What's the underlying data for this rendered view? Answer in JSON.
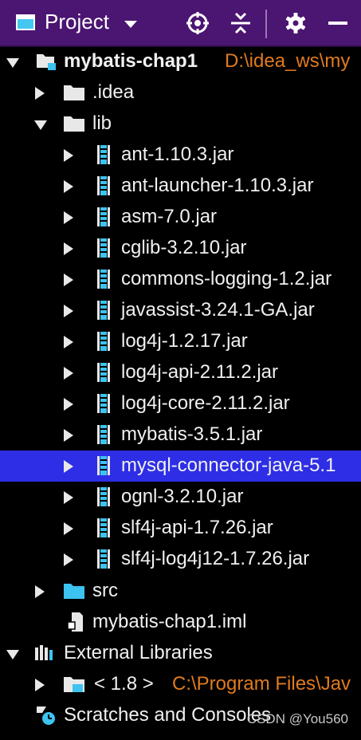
{
  "header": {
    "title": "Project"
  },
  "tree": {
    "root": {
      "label": "mybatis-chap1",
      "path": "D:\\idea_ws\\my"
    },
    "idea": {
      "label": ".idea"
    },
    "lib": {
      "label": "lib",
      "jars": [
        "ant-1.10.3.jar",
        "ant-launcher-1.10.3.jar",
        "asm-7.0.jar",
        "cglib-3.2.10.jar",
        "commons-logging-1.2.jar",
        "javassist-3.24.1-GA.jar",
        "log4j-1.2.17.jar",
        "log4j-api-2.11.2.jar",
        "log4j-core-2.11.2.jar",
        "mybatis-3.5.1.jar",
        "mysql-connector-java-5.1",
        "ognl-3.2.10.jar",
        "slf4j-api-1.7.26.jar",
        "slf4j-log4j12-1.7.26.jar"
      ]
    },
    "src": {
      "label": "src"
    },
    "iml": {
      "label": "mybatis-chap1.iml"
    },
    "external": {
      "label": "External Libraries"
    },
    "jdk": {
      "label": "< 1.8 >",
      "path": "C:\\Program Files\\Jav"
    },
    "scratches": {
      "label": "Scratches and Consoles"
    }
  },
  "selected_index": 10,
  "watermark": "CSDN @You560",
  "colors": {
    "header": "#4b1572",
    "selection": "#2e2ee6",
    "path": "#e07a1f",
    "folder_src": "#3cc3f0"
  }
}
